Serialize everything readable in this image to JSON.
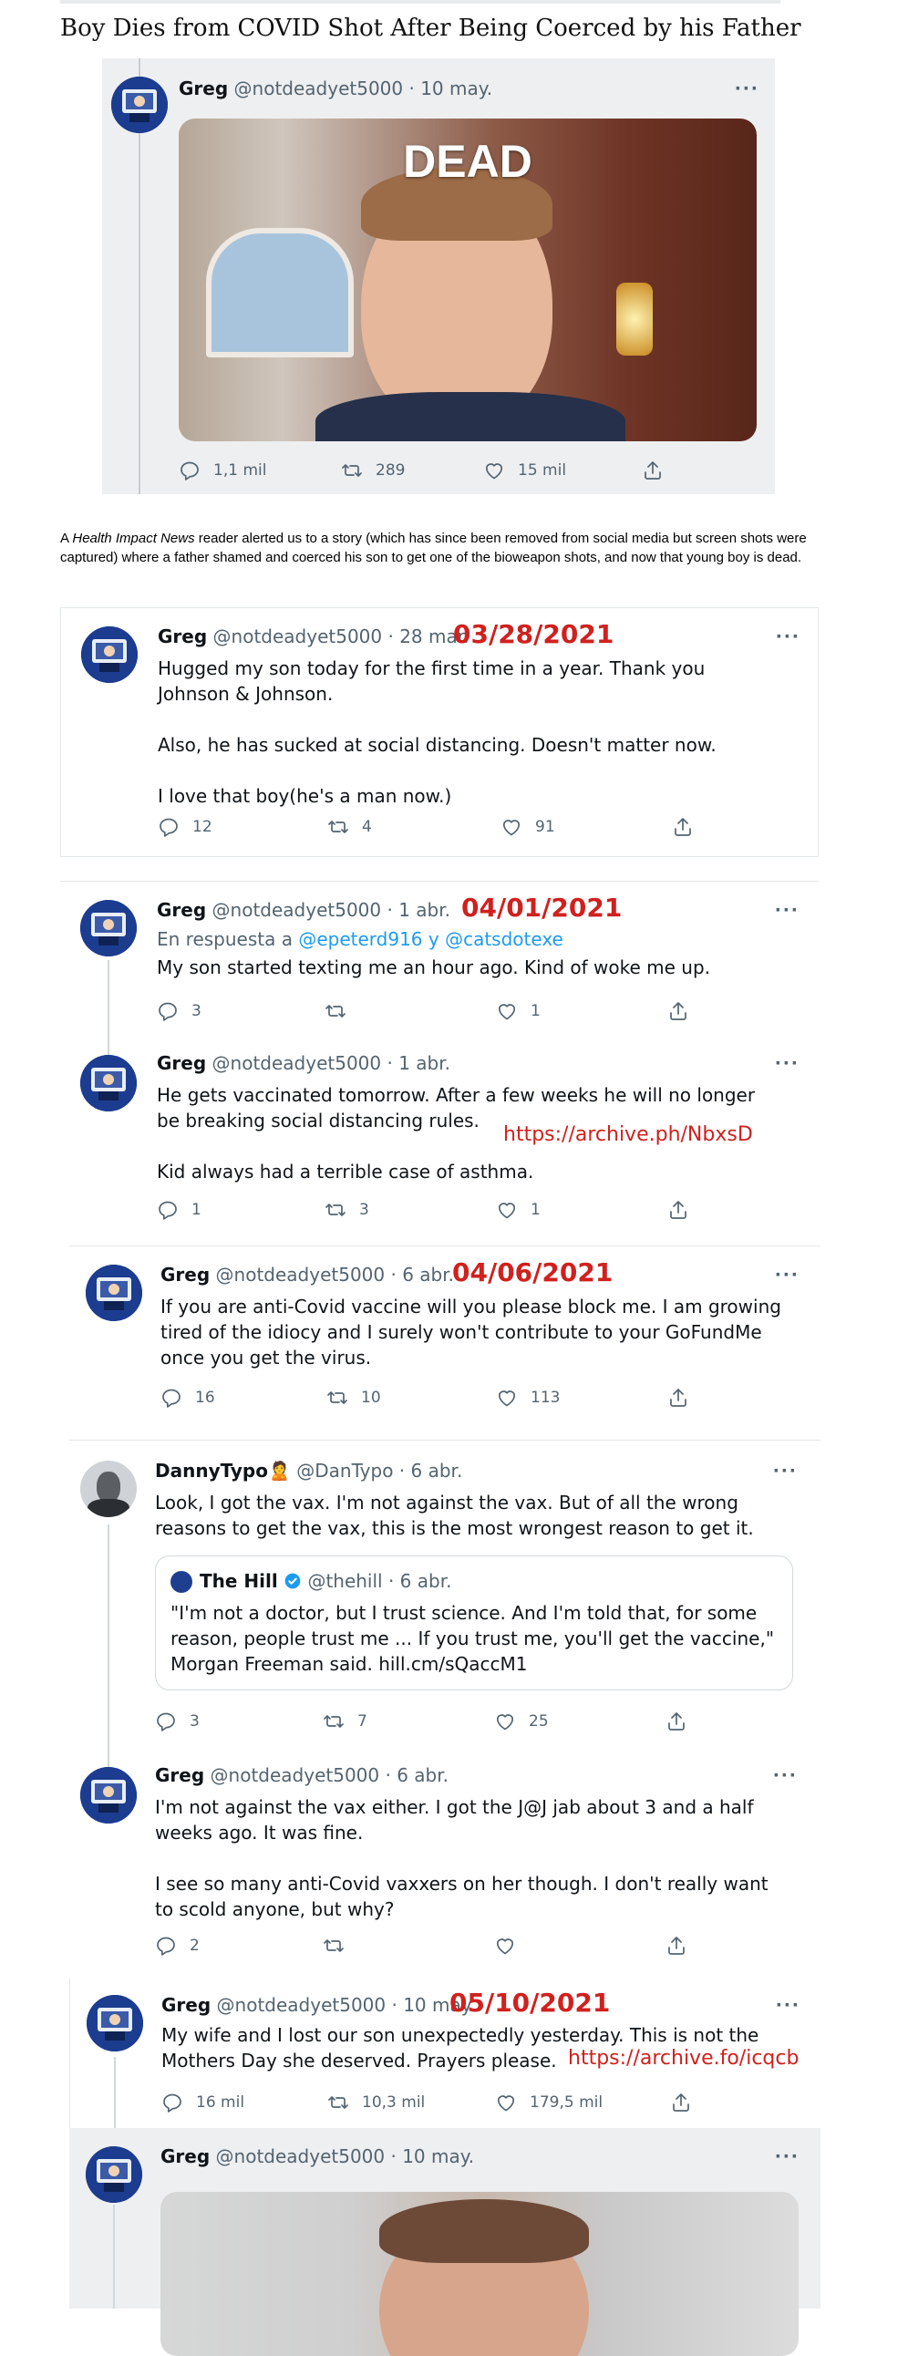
{
  "headline": "Boy Dies from COVID Shot After Being Coerced by his Father",
  "intro": {
    "prefix": "A ",
    "source": "Health Impact News",
    "text": " reader alerted us to a story (which has since been removed from social media but screen shots were captured) where a father shamed and coerced his son to get one of the bioweapon shots, and now that young boy is dead."
  },
  "overlay_labels": {
    "dead": "DEAD",
    "date_1": "03/28/2021",
    "date_2": "04/01/2021",
    "date_3": "04/06/2021",
    "date_4": "05/10/2021",
    "archive_1": "https://archive.ph/NbxsD",
    "archive_2": "https://archive.fo/icqcb"
  },
  "icons": [
    "reply-icon",
    "retweet-icon",
    "like-icon",
    "share-icon",
    "more-icon",
    "verified-icon"
  ],
  "tweets": [
    {
      "id": "t1",
      "name": "Greg",
      "meta": "@notdeadyet5000 · 10 may.",
      "replies": "1,1 mil",
      "retweets": "289",
      "likes": "15 mil"
    },
    {
      "id": "t2",
      "name": "Greg",
      "meta": "@notdeadyet5000 · 28 mar.",
      "text": [
        "Hugged my son today for the first time in a year. Thank you Johnson & Johnson.",
        "Also, he has sucked at social distancing. Doesn't matter now.",
        "I love that boy(he's a man now.)"
      ],
      "replies": "12",
      "retweets": "4",
      "likes": "91"
    },
    {
      "id": "t3",
      "name": "Greg",
      "meta": "@notdeadyet5000 · 1 abr.",
      "reply_prefix": "En respuesta a ",
      "reply_to": "@epeterd916 y @catsdotexe",
      "text": [
        "My son started texting me an hour ago. Kind of woke me up."
      ],
      "replies": "3",
      "retweets": "",
      "likes": "1"
    },
    {
      "id": "t4",
      "name": "Greg",
      "meta": "@notdeadyet5000 · 1 abr.",
      "text": [
        "He gets vaccinated tomorrow. After a few weeks he will no longer be breaking social distancing rules.",
        "Kid always had a terrible case of asthma."
      ],
      "replies": "1",
      "retweets": "3",
      "likes": "1"
    },
    {
      "id": "t5",
      "name": "Greg",
      "meta": "@notdeadyet5000 · 6 abr.",
      "text": [
        "If you are anti-Covid vaccine will you please block me. I am growing tired of the idiocy and I surely won't contribute to your GoFundMe once you get the virus."
      ],
      "replies": "16",
      "retweets": "10",
      "likes": "113"
    },
    {
      "id": "t6",
      "name": "DannyTypo🙎",
      "meta": "@DanTypo · 6 abr.",
      "text": [
        "Look, I got the vax. I'm not against the vax. But of all the wrong reasons to get the vax, this is the most wrongest reason to get it."
      ],
      "quote": {
        "name": "The Hill",
        "meta": "@thehill · 6 abr.",
        "text": "\"I'm not a doctor, but I trust science. And I'm told that, for some reason, people trust me ... If you trust me, you'll get the vaccine,\" Morgan Freeman said. hill.cm/sQaccM1"
      },
      "replies": "3",
      "retweets": "7",
      "likes": "25"
    },
    {
      "id": "t7",
      "name": "Greg",
      "meta": "@notdeadyet5000 · 6 abr.",
      "text": [
        "I'm not against the vax either. I got the J@J jab about 3 and a half weeks ago. It was fine.",
        "I see so many anti-Covid vaxxers on her though. I don't really want to scold anyone, but why?"
      ],
      "replies": "2",
      "retweets": "",
      "likes": ""
    },
    {
      "id": "t8",
      "name": "Greg",
      "meta": "@notdeadyet5000 · 10 may.",
      "text": [
        "My wife and I lost our son unexpectedly yesterday. This is not the Mothers Day she deserved. Prayers please."
      ],
      "replies": "16 mil",
      "retweets": "10,3 mil",
      "likes": "179,5 mil"
    },
    {
      "id": "t9",
      "name": "Greg",
      "meta": "@notdeadyet5000 · 10 may."
    }
  ]
}
